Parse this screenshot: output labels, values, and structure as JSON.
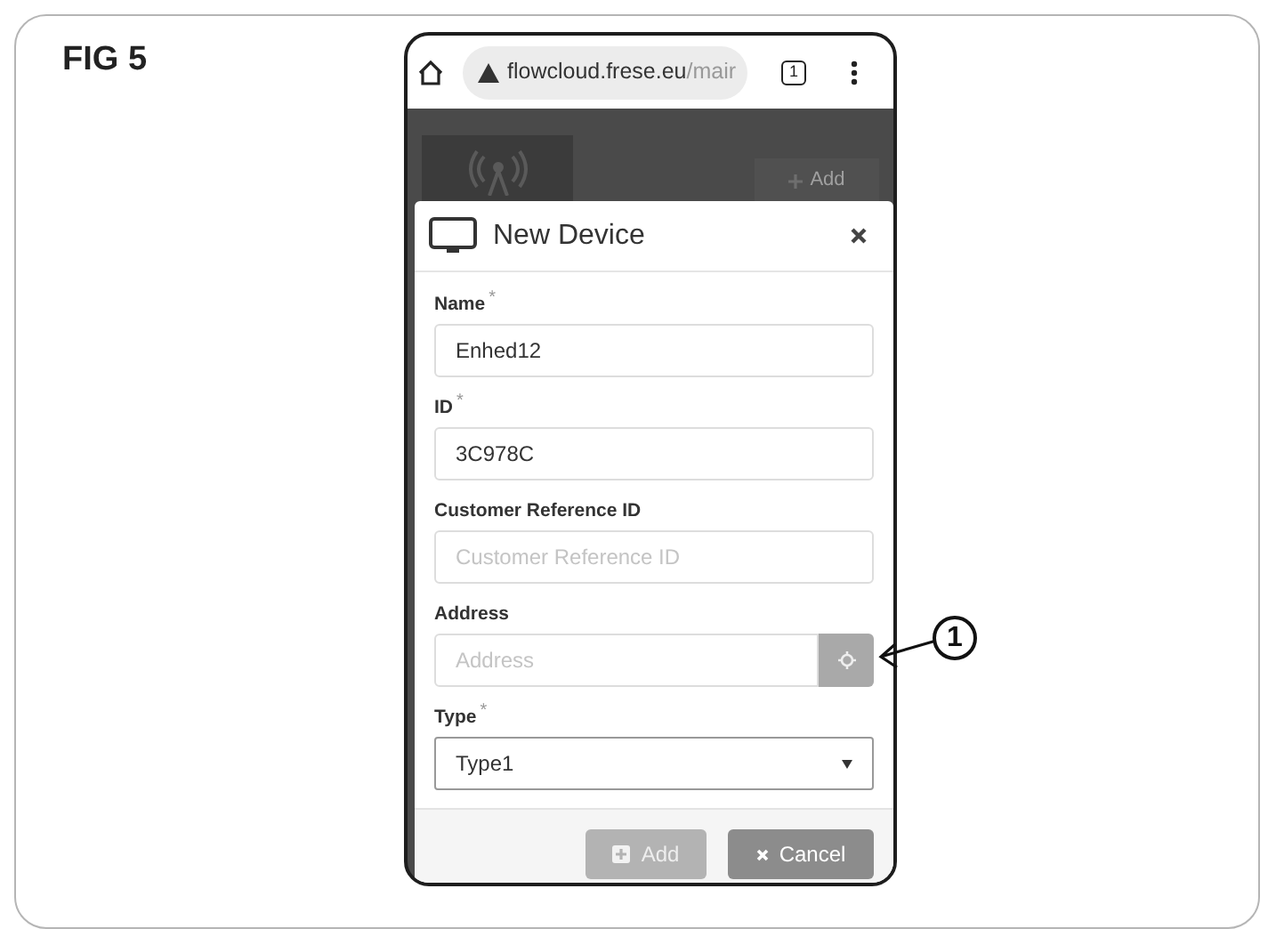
{
  "figure_label": "FIG 5",
  "browser": {
    "url_domain": "flowcloud.frese.eu",
    "url_path": "/mair",
    "tab_count": "1"
  },
  "background": {
    "add_button": "Add"
  },
  "dialog": {
    "title": "New Device",
    "fields": [
      {
        "kind": "text",
        "label": "Name",
        "required_mark": "*",
        "value": "Enhed12"
      },
      {
        "kind": "text",
        "label": "ID",
        "required_mark": "*",
        "value": "3C978C"
      },
      {
        "kind": "text",
        "label": "Customer Reference ID",
        "placeholder": "Customer Reference ID"
      },
      {
        "kind": "location",
        "label": "Address",
        "placeholder": "Address"
      },
      {
        "kind": "select",
        "label": "Type",
        "required_mark": "*",
        "value": "Type1"
      }
    ],
    "buttons": [
      {
        "kind": "add",
        "label": "Add",
        "disabled": true
      },
      {
        "kind": "cancel",
        "label": "Cancel",
        "disabled": false
      }
    ]
  },
  "callout": "1"
}
